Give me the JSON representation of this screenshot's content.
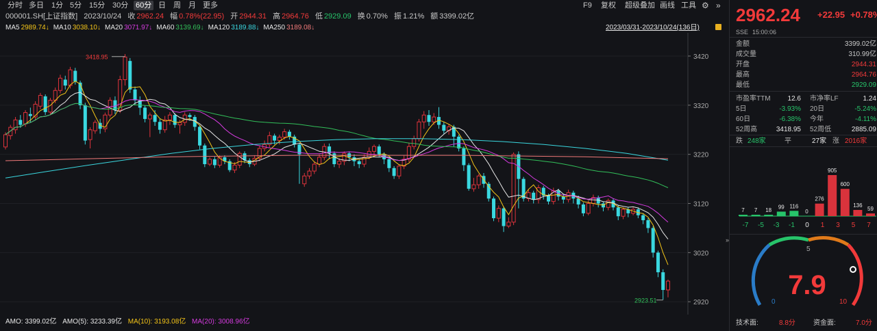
{
  "toolbar": {
    "periods": [
      "分时",
      "多日",
      "1分",
      "5分",
      "15分",
      "30分",
      "60分",
      "日",
      "周",
      "月",
      "更多"
    ],
    "active_period": "60分",
    "right_items": [
      "F9",
      "复权",
      "超级叠加",
      "画线",
      "工具"
    ]
  },
  "quote_line": {
    "code": "000001.SH[上证指数]",
    "date": "2023/10/24",
    "close_label": "收",
    "close": "2962.24",
    "change_label": "幅",
    "change": "0.78%(22.95)",
    "open_label": "开",
    "open": "2944.31",
    "high_label": "高",
    "high": "2964.76",
    "low_label": "低",
    "low": "2929.09",
    "turnover_label": "换",
    "turnover": "0.70%",
    "amplitude_label": "振",
    "amplitude": "1.21%",
    "amount_label": "额",
    "amount": "3399.02亿"
  },
  "ma_line": {
    "items": [
      {
        "label": "MA5",
        "value": "2989.74↓",
        "color": "#e8e8e8",
        "vcolor": "#f5c518"
      },
      {
        "label": "MA10",
        "value": "3038.10↓",
        "color": "#e8e8e8",
        "vcolor": "#f5c518"
      },
      {
        "label": "MA20",
        "value": "3071.97↓",
        "color": "#e8e8e8",
        "vcolor": "#d63be0"
      },
      {
        "label": "MA60",
        "value": "3139.69↓",
        "color": "#e8e8e8",
        "vcolor": "#32c05a"
      },
      {
        "label": "MA120",
        "value": "3189.88↓",
        "color": "#e8e8e8",
        "vcolor": "#3ad8e0"
      },
      {
        "label": "MA250",
        "value": "3189.08↓",
        "color": "#e8e8e8",
        "vcolor": "#f27a7a"
      }
    ],
    "range": "2023/03/31-2023/10/24(136日)"
  },
  "amo_line": {
    "amo": "AMO: 3399.02亿",
    "ma5": "AMO(5): 3233.39亿",
    "ma10": "MA(10): 3193.08亿",
    "ma20": "MA(20): 3008.96亿"
  },
  "chart_data": {
    "type": "candlestick",
    "y_ticks": [
      3420,
      3320,
      3220,
      3120,
      3020,
      2920
    ],
    "ylim": [
      2905,
      3445
    ],
    "annotations": {
      "max": "3418.95",
      "min": "2923.51"
    },
    "candles": [
      [
        3235,
        3260,
        3230,
        3265
      ],
      [
        3258,
        3275,
        3250,
        3280
      ],
      [
        3270,
        3290,
        3262,
        3296
      ],
      [
        3290,
        3280,
        3274,
        3300
      ],
      [
        3282,
        3305,
        3276,
        3310
      ],
      [
        3302,
        3298,
        3285,
        3315
      ],
      [
        3296,
        3322,
        3290,
        3328
      ],
      [
        3318,
        3340,
        3312,
        3345
      ],
      [
        3338,
        3306,
        3300,
        3342
      ],
      [
        3306,
        3330,
        3300,
        3335
      ],
      [
        3330,
        3350,
        3324,
        3356
      ],
      [
        3350,
        3375,
        3344,
        3382
      ],
      [
        3372,
        3360,
        3352,
        3380
      ],
      [
        3360,
        3392,
        3354,
        3398
      ],
      [
        3390,
        3368,
        3362,
        3396
      ],
      [
        3366,
        3320,
        3312,
        3370
      ],
      [
        3320,
        3248,
        3240,
        3325
      ],
      [
        3250,
        3270,
        3232,
        3275
      ],
      [
        3268,
        3285,
        3262,
        3290
      ],
      [
        3284,
        3272,
        3262,
        3292
      ],
      [
        3272,
        3300,
        3265,
        3305
      ],
      [
        3300,
        3330,
        3295,
        3336
      ],
      [
        3330,
        3310,
        3302,
        3338
      ],
      [
        3310,
        3372,
        3304,
        3380
      ],
      [
        3372,
        3418,
        3360,
        3424
      ],
      [
        3410,
        3352,
        3345,
        3416
      ],
      [
        3352,
        3330,
        3320,
        3358
      ],
      [
        3330,
        3315,
        3300,
        3338
      ],
      [
        3315,
        3292,
        3285,
        3320
      ],
      [
        3292,
        3300,
        3255,
        3305
      ],
      [
        3300,
        3286,
        3278,
        3310
      ],
      [
        3286,
        3270,
        3262,
        3292
      ],
      [
        3270,
        3290,
        3264,
        3298
      ],
      [
        3290,
        3300,
        3280,
        3306
      ],
      [
        3300,
        3280,
        3274,
        3304
      ],
      [
        3280,
        3285,
        3262,
        3290
      ],
      [
        3285,
        3300,
        3278,
        3306
      ],
      [
        3300,
        3296,
        3288,
        3304
      ],
      [
        3296,
        3276,
        3268,
        3300
      ],
      [
        3276,
        3238,
        3230,
        3280
      ],
      [
        3238,
        3200,
        3194,
        3242
      ],
      [
        3200,
        3210,
        3196,
        3214
      ],
      [
        3210,
        3198,
        3192,
        3215
      ],
      [
        3198,
        3214,
        3193,
        3218
      ],
      [
        3214,
        3206,
        3200,
        3218
      ],
      [
        3206,
        3188,
        3184,
        3210
      ],
      [
        3188,
        3198,
        3182,
        3204
      ],
      [
        3198,
        3222,
        3192,
        3226
      ],
      [
        3222,
        3208,
        3202,
        3226
      ],
      [
        3208,
        3200,
        3194,
        3212
      ],
      [
        3200,
        3212,
        3196,
        3218
      ],
      [
        3212,
        3232,
        3206,
        3238
      ],
      [
        3232,
        3240,
        3226,
        3248
      ],
      [
        3240,
        3258,
        3234,
        3266
      ],
      [
        3258,
        3248,
        3240,
        3262
      ],
      [
        3248,
        3255,
        3240,
        3260
      ],
      [
        3255,
        3266,
        3250,
        3272
      ],
      [
        3266,
        3256,
        3250,
        3270
      ],
      [
        3256,
        3240,
        3234,
        3260
      ],
      [
        3240,
        3220,
        3160,
        3244
      ],
      [
        3160,
        3176,
        3154,
        3182
      ],
      [
        3176,
        3186,
        3170,
        3192
      ],
      [
        3186,
        3200,
        3180,
        3206
      ],
      [
        3200,
        3214,
        3194,
        3220
      ],
      [
        3214,
        3236,
        3208,
        3242
      ],
      [
        3236,
        3222,
        3210,
        3242
      ],
      [
        3222,
        3200,
        3194,
        3226
      ],
      [
        3200,
        3206,
        3192,
        3212
      ],
      [
        3206,
        3222,
        3198,
        3226
      ],
      [
        3222,
        3214,
        3206,
        3226
      ],
      [
        3214,
        3206,
        3196,
        3220
      ],
      [
        3206,
        3200,
        3192,
        3210
      ],
      [
        3200,
        3214,
        3194,
        3220
      ],
      [
        3214,
        3226,
        3210,
        3234
      ],
      [
        3226,
        3236,
        3218,
        3240
      ],
      [
        3236,
        3220,
        3214,
        3240
      ],
      [
        3220,
        3210,
        3200,
        3224
      ],
      [
        3210,
        3192,
        3184,
        3214
      ],
      [
        3192,
        3176,
        3170,
        3196
      ],
      [
        3176,
        3196,
        3170,
        3200
      ],
      [
        3196,
        3210,
        3190,
        3218
      ],
      [
        3210,
        3236,
        3204,
        3244
      ],
      [
        3236,
        3252,
        3230,
        3258
      ],
      [
        3252,
        3286,
        3246,
        3292
      ],
      [
        3286,
        3300,
        3272,
        3308
      ],
      [
        3300,
        3286,
        3278,
        3310
      ],
      [
        3286,
        3296,
        3280,
        3304
      ],
      [
        3296,
        3280,
        3272,
        3316
      ],
      [
        3280,
        3268,
        3262,
        3286
      ],
      [
        3268,
        3276,
        3260,
        3282
      ],
      [
        3276,
        3256,
        3236,
        3280
      ],
      [
        3256,
        3232,
        3226,
        3260
      ],
      [
        3232,
        3198,
        3186,
        3236
      ],
      [
        3198,
        3150,
        3146,
        3202
      ],
      [
        3150,
        3158,
        3144,
        3172
      ],
      [
        3158,
        3176,
        3150,
        3180
      ],
      [
        3176,
        3160,
        3152,
        3182
      ],
      [
        3160,
        3130,
        3124,
        3164
      ],
      [
        3130,
        3090,
        3084,
        3134
      ],
      [
        3090,
        3110,
        3082,
        3116
      ],
      [
        3110,
        3074,
        3062,
        3114
      ],
      [
        3074,
        3082,
        3070,
        3092
      ],
      [
        3082,
        3220,
        3076,
        3224
      ],
      [
        3220,
        3170,
        3110,
        3226
      ],
      [
        3170,
        3130,
        3124,
        3174
      ],
      [
        3130,
        3142,
        3124,
        3148
      ],
      [
        3142,
        3128,
        3120,
        3146
      ],
      [
        3128,
        3152,
        3120,
        3158
      ],
      [
        3152,
        3136,
        3128,
        3156
      ],
      [
        3136,
        3124,
        3118,
        3140
      ],
      [
        3124,
        3146,
        3118,
        3152
      ],
      [
        3146,
        3134,
        3126,
        3150
      ],
      [
        3134,
        3128,
        3120,
        3140
      ],
      [
        3128,
        3142,
        3122,
        3148
      ],
      [
        3142,
        3130,
        3120,
        3146
      ],
      [
        3130,
        3118,
        3110,
        3136
      ],
      [
        3118,
        3100,
        3094,
        3122
      ],
      [
        3100,
        3120,
        3096,
        3126
      ],
      [
        3120,
        3132,
        3114,
        3138
      ],
      [
        3132,
        3120,
        3112,
        3136
      ],
      [
        3120,
        3112,
        3104,
        3124
      ],
      [
        3112,
        3126,
        3106,
        3130
      ],
      [
        3126,
        3112,
        3106,
        3130
      ],
      [
        3112,
        3094,
        3086,
        3116
      ],
      [
        3094,
        3108,
        3088,
        3112
      ],
      [
        3108,
        3100,
        3092,
        3112
      ],
      [
        3100,
        3108,
        3096,
        3112
      ],
      [
        3108,
        3096,
        3090,
        3112
      ],
      [
        3096,
        3086,
        3078,
        3100
      ],
      [
        3086,
        3070,
        3060,
        3090
      ],
      [
        3070,
        3020,
        3010,
        3074
      ],
      [
        3020,
        2980,
        2970,
        3024
      ],
      [
        2980,
        2944,
        2924,
        2986
      ],
      [
        2944,
        2962,
        2929,
        2965
      ]
    ]
  },
  "panel": {
    "price": "2962.24",
    "change": "+22.95",
    "change_pct": "+0.78%",
    "exchange": "SSE",
    "time": "15:00:06",
    "rows": [
      {
        "label": "金额",
        "value": "3399.02亿",
        "cls": ""
      },
      {
        "label": "成交量",
        "value": "310.99亿",
        "cls": ""
      },
      {
        "label": "开盘",
        "value": "2944.31",
        "cls": "up"
      },
      {
        "label": "最高",
        "value": "2964.76",
        "cls": "up"
      },
      {
        "label": "最低",
        "value": "2929.09",
        "cls": "down"
      }
    ],
    "stats": [
      [
        "市盈率TTM",
        "12.6",
        "",
        "市净率LF",
        "1.24",
        ""
      ],
      [
        "5日",
        "-3.93%",
        "down",
        "20日",
        "-5.24%",
        "down"
      ],
      [
        "60日",
        "-6.38%",
        "down",
        "今年",
        "-4.11%",
        "down"
      ],
      [
        "52周高",
        "3418.95",
        "",
        "52周低",
        "2885.09",
        ""
      ]
    ],
    "breadth": {
      "down_label": "跌",
      "down": "248家",
      "flat_label": "平",
      "flat": "27家",
      "up_label": "涨",
      "up": "2016家"
    },
    "dist": {
      "bars": [
        7,
        7,
        18,
        99,
        116,
        0,
        276,
        905,
        600,
        136,
        59
      ],
      "colors": [
        "#27c46a",
        "#27c46a",
        "#27c46a",
        "#27c46a",
        "#27c46a",
        "#888",
        "#d9333c",
        "#d9333c",
        "#d9333c",
        "#d9333c",
        "#d9333c"
      ],
      "ticks": [
        "-7",
        "-5",
        "-3",
        "-1",
        "0",
        "1",
        "3",
        "5",
        "7"
      ]
    },
    "gauge": {
      "value": "7.9",
      "min_label": "0",
      "mid_label": "5",
      "max_label": "10"
    },
    "tech_label": "技术面:",
    "tech_value": "8.8分",
    "fund_label": "资金面:",
    "fund_value": "7.0分"
  }
}
